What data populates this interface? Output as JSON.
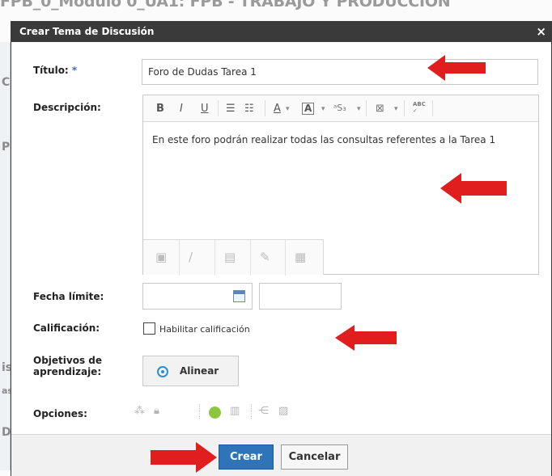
{
  "background": {
    "page_title": "FPB_0_Módulo 0_UA1: FPB - TRABAJO Y PRODUCCION",
    "edge_letters": [
      "C",
      "P",
      "is",
      "as",
      "D"
    ]
  },
  "dialog": {
    "title": "Crear Tema de Discusión",
    "close_label": "×",
    "titulo_label": "Título:",
    "required_mark": "*",
    "titulo_value": "Foro de Dudas Tarea 1",
    "descripcion_label": "Descripción:",
    "editor": {
      "toolbar": {
        "bold": "B",
        "italic": "I",
        "underline": "U",
        "unordered_list": "☰",
        "ordered_list": "☷",
        "font_color": "A",
        "bg_color": "A",
        "superscript": "ᵃS₃",
        "insert": "⊠",
        "spellcheck": "ABC"
      },
      "content": "En este foro podrán realizar todas las consultas referentes a la Tarea 1"
    },
    "fecha_label": "Fecha límite:",
    "calificacion_label": "Calificación:",
    "habilitar_label": "Habilitar calificación",
    "objetivos_label_line1": "Objetivos de",
    "objetivos_label_line2": "aprendizaje:",
    "alinear_label": "Alinear",
    "opciones_label": "Opciones:",
    "crear_label": "Crear",
    "cancelar_label": "Cancelar"
  },
  "colors": {
    "titlebar": "#3a3a3a",
    "primary_button": "#2e74b8",
    "annotation_arrow": "#e01e1e",
    "status_green": "#8cc63f"
  }
}
